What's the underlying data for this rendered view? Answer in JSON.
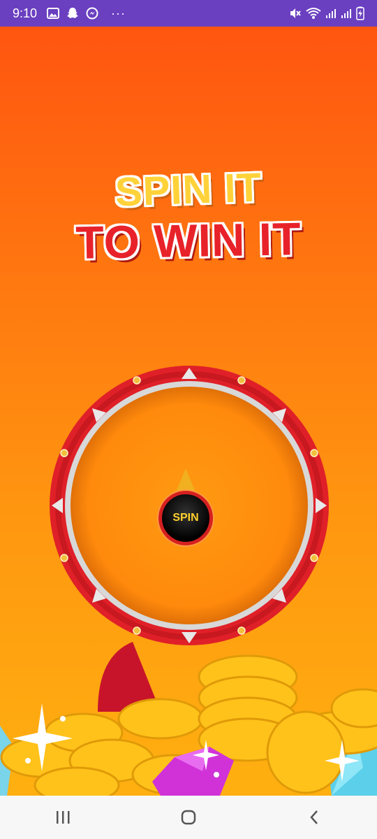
{
  "status_bar": {
    "time": "9:10",
    "left_icons": [
      "image-icon",
      "snapchat-icon",
      "messenger-icon"
    ],
    "more": "···",
    "right_icons": [
      "mute-icon",
      "wifi-icon",
      "signal-icon",
      "signal-icon",
      "battery-icon"
    ]
  },
  "headline": {
    "line1": "SPIN IT",
    "line2": "TO WIN IT"
  },
  "wheel": {
    "spin_label": "SPIN"
  },
  "nav": {
    "recents": "recents-icon",
    "home": "home-icon",
    "back": "back-icon"
  },
  "colors": {
    "status_bar": "#6a3fc0",
    "wheel_rim": "#e02028",
    "headline_yellow": "#ffd23a",
    "headline_red": "#e8222a"
  }
}
